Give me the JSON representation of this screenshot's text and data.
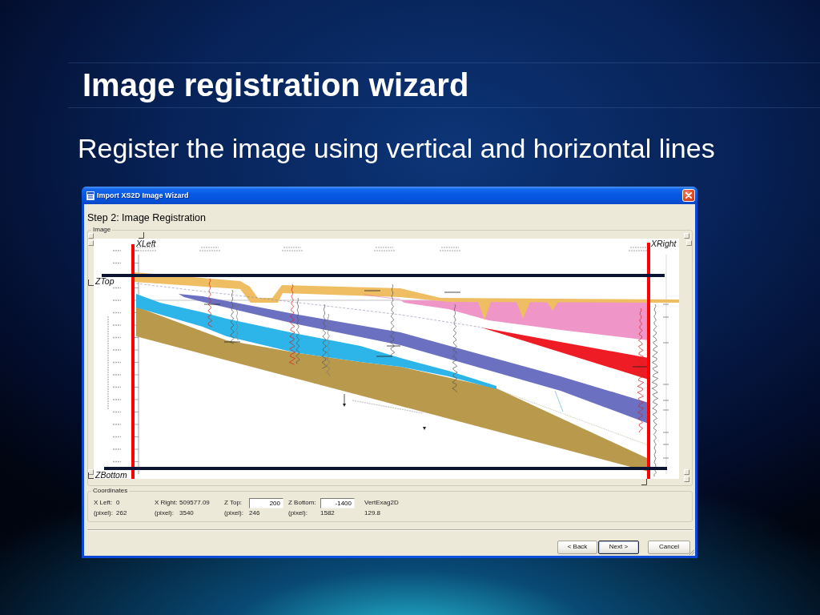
{
  "slide": {
    "title": "Image registration wizard",
    "subtitle": "Register the image using vertical and horizontal lines"
  },
  "window": {
    "title": "Import XS2D Image Wizard",
    "step": "Step 2: Image Registration",
    "image_group": {
      "label": "Image",
      "markers": [
        {
          "kind": "vertical",
          "label": "XLeft"
        },
        {
          "kind": "vertical",
          "label": "XRight"
        },
        {
          "kind": "horizontal",
          "label": "ZTop"
        },
        {
          "kind": "horizontal",
          "label": "ZBottom"
        }
      ]
    },
    "coordinates": {
      "label": "Coordinates",
      "columns": [
        {
          "kind": "text",
          "label": "X Left:",
          "value": "0",
          "pixel_label": "(pixel):",
          "pixel": "262"
        },
        {
          "kind": "text",
          "label": "X Right:",
          "value": "509577.09",
          "pixel_label": "(pixel):",
          "pixel": "3540"
        },
        {
          "kind": "field",
          "label": "Z Top:",
          "value": "200",
          "pixel_label": "(pixel):",
          "pixel": "246"
        },
        {
          "kind": "field",
          "label": "Z Bottom:",
          "value": "-1400",
          "pixel_label": "(pixel):",
          "pixel": "1582"
        },
        {
          "kind": "readout",
          "label": "VertExag2D",
          "value": "129.8"
        }
      ]
    },
    "buttons": [
      {
        "label": "< Back",
        "default": false
      },
      {
        "label": "Next >",
        "default": true
      },
      {
        "label": "Cancel",
        "default": false
      }
    ]
  }
}
